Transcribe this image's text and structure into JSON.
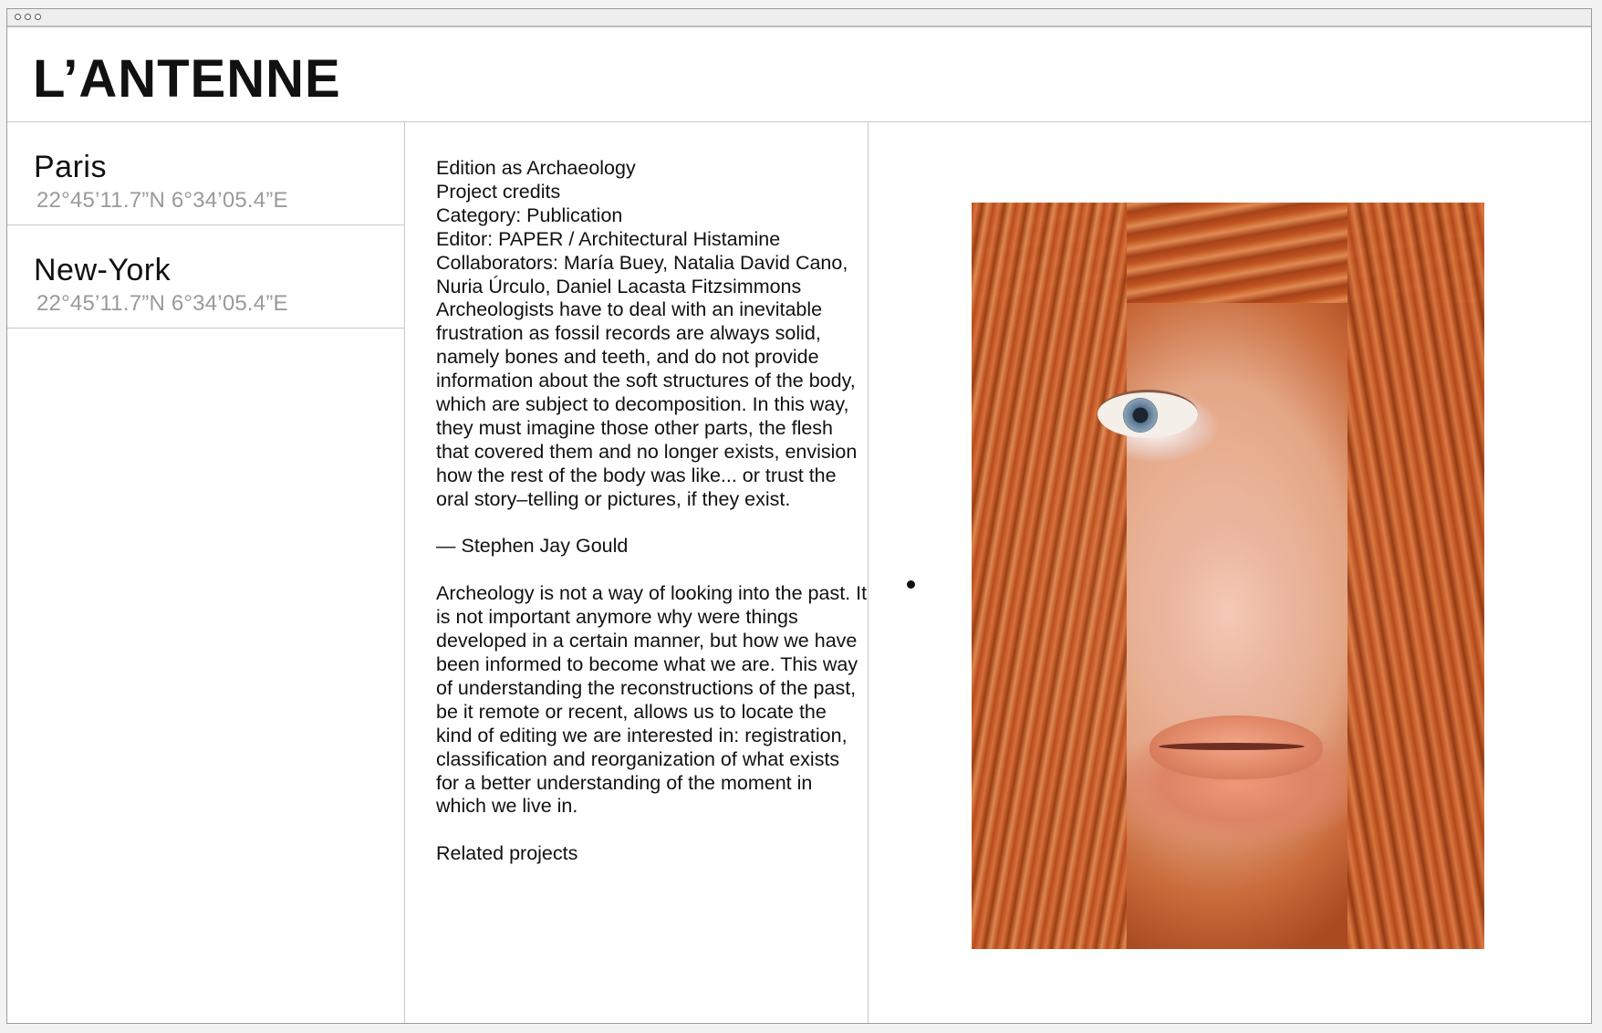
{
  "window": {
    "controls": [
      "close",
      "minimize",
      "maximize"
    ]
  },
  "header": {
    "logo": "L’ANTENNE"
  },
  "locations": [
    {
      "name": "Paris",
      "coords": "22°45’11.7”N  6°34’05.4”E"
    },
    {
      "name": "New-York",
      "coords": "22°45’11.7”N  6°34’05.4”E"
    }
  ],
  "project": {
    "title": "Edition as Archaeology",
    "credits_label": "Project credits",
    "category": "Category: Publication",
    "editor": "Editor: PAPER / Architectural Histamine",
    "collaborators": "Collaborators: María Buey, Natalia David Cano, Nuria Úrculo, Daniel Lacasta Fitzsimmons",
    "quote": " Archeologists have to deal with an inevitable frustration as fossil records are always solid, namely bones and teeth, and do not provide information about the soft structures of the body, which are subject to decomposition. In this way, they must imagine those other parts, the flesh that covered them and no longer exists, envision how the rest of the body was like... or trust the oral story–telling or pictures, if they exist.",
    "quote_author": "— Stephen Jay Gould",
    "body": "Archeology is not a way of looking into the past. It is not important anymore why were things developed in a certain manner, but how we have been informed to become what we are. This way of understanding the reconstructions of the past, be it remote or recent, allows us to locate the kind of editing we are interested in: registration, classification and reorganization of what exists for a better understanding of the moment in which we live in.",
    "related_label": "Related projects"
  },
  "image": {
    "subject": "portrait of a woman with curly red hair"
  }
}
